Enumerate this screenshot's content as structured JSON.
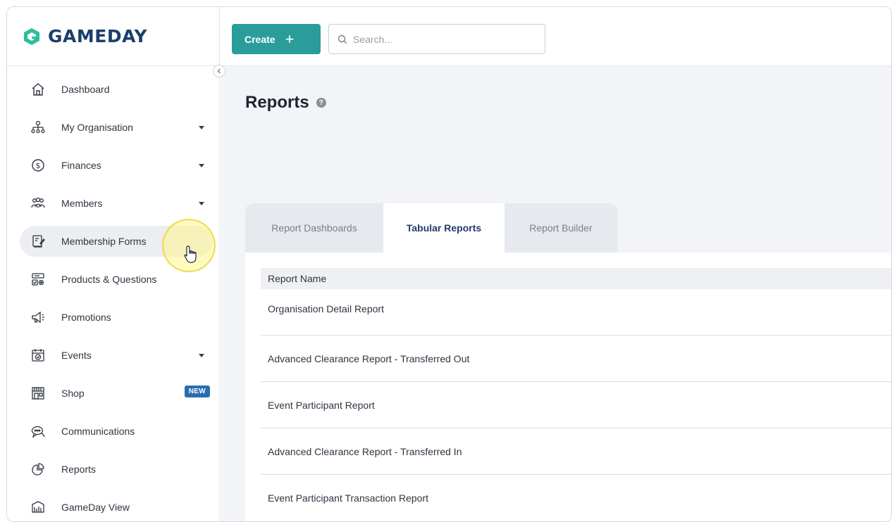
{
  "brand": {
    "name": "GAMEDAY",
    "accent": "#2a9d9a"
  },
  "topbar": {
    "create_label": "Create",
    "search_placeholder": "Search..."
  },
  "sidebar": {
    "items": [
      {
        "label": "Dashboard",
        "icon": "home-icon",
        "caret": false
      },
      {
        "label": "My Organisation",
        "icon": "org-chart-icon",
        "caret": true
      },
      {
        "label": "Finances",
        "icon": "dollar-icon",
        "caret": true
      },
      {
        "label": "Members",
        "icon": "people-icon",
        "caret": true
      },
      {
        "label": "Membership Forms",
        "icon": "form-icon",
        "caret": false
      },
      {
        "label": "Products & Questions",
        "icon": "products-icon",
        "caret": false
      },
      {
        "label": "Promotions",
        "icon": "megaphone-icon",
        "caret": false
      },
      {
        "label": "Events",
        "icon": "calendar-icon",
        "caret": true
      },
      {
        "label": "Shop",
        "icon": "shop-icon",
        "caret": false,
        "badge": "NEW"
      },
      {
        "label": "Communications",
        "icon": "chat-icon",
        "caret": false
      },
      {
        "label": "Reports",
        "icon": "pie-chart-icon",
        "caret": false
      },
      {
        "label": "GameDay View",
        "icon": "view-icon",
        "caret": false
      }
    ]
  },
  "page": {
    "title": "Reports",
    "tabs": [
      {
        "label": "Report Dashboards"
      },
      {
        "label": "Tabular Reports"
      },
      {
        "label": "Report Builder"
      }
    ],
    "table": {
      "header": "Report Name",
      "rows": [
        "Organisation Detail Report",
        "Advanced Clearance Report - Transferred Out",
        "Event Participant Report",
        "Advanced Clearance Report - Transferred In",
        "Event Participant Transaction Report"
      ]
    }
  }
}
